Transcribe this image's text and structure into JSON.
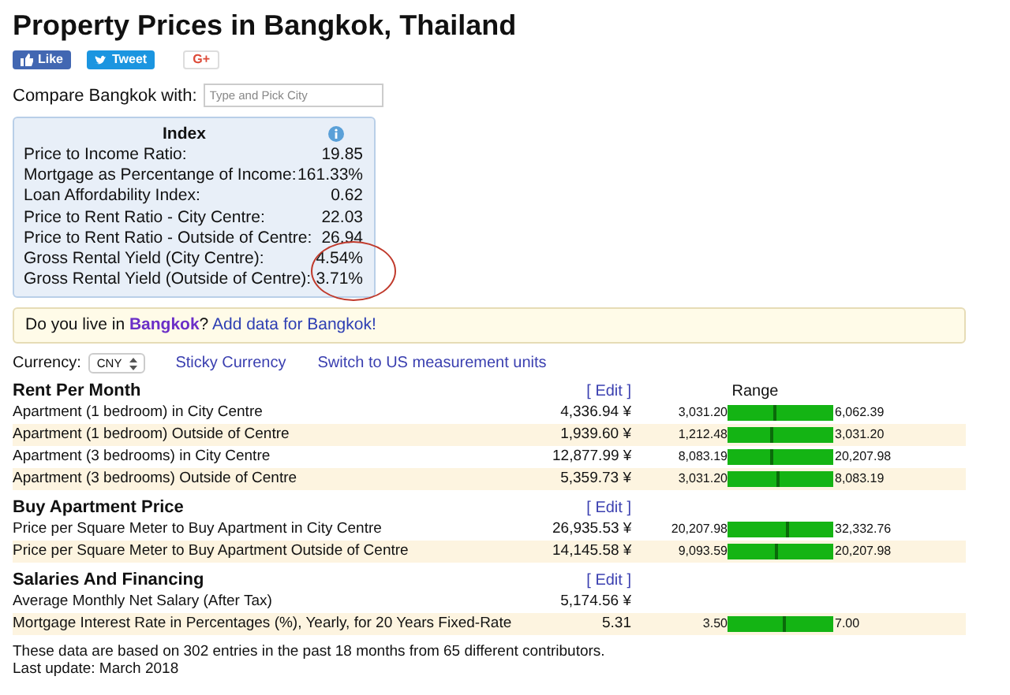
{
  "title": "Property Prices in Bangkok, Thailand",
  "social": [
    {
      "kind": "like",
      "label": "Like"
    },
    {
      "kind": "tweet",
      "label": "Tweet"
    },
    {
      "kind": "gplus",
      "label": "G+"
    }
  ],
  "compare": {
    "label": "Compare Bangkok with:",
    "placeholder": "Type and Pick City"
  },
  "index": {
    "title": "Index",
    "rows": [
      {
        "label": "Price to Income Ratio:",
        "value": "19.85",
        "circled": false
      },
      {
        "label": "Mortgage as Percentange of Income:",
        "value": "161.33%",
        "circled": false
      },
      {
        "label": "Loan Affordability Index:",
        "value": "0.62",
        "circled": false
      },
      {
        "label": "Price to Rent Ratio - City Centre:",
        "value": "22.03",
        "circled": false
      },
      {
        "label": "Price to Rent Ratio - Outside of Centre:",
        "value": "26.94",
        "circled": false
      },
      {
        "label": "Gross Rental Yield (City Centre):",
        "value": "4.54%",
        "circled": true
      },
      {
        "label": "Gross Rental Yield (Outside of Centre):",
        "value": "3.71%",
        "circled": true
      }
    ]
  },
  "notice": {
    "before": "Do you live in ",
    "city_link": "Bangkok",
    "between": "?",
    "add_link": "Add data for Bangkok!"
  },
  "currency": {
    "label": "Currency:",
    "value": "CNY",
    "links": [
      "Sticky Currency",
      "Switch to US measurement units"
    ]
  },
  "sections": [
    {
      "title": "Rent Per Month",
      "edit": "[ Edit ]",
      "range_heading": "Range",
      "rows": [
        {
          "label": "Apartment (1 bedroom) in City Centre",
          "value": "4,336.94 ¥",
          "low": "3,031.20",
          "high": "6,062.39",
          "level": 0.43
        },
        {
          "label": "Apartment (1 bedroom) Outside of Centre",
          "value": "1,939.60 ¥",
          "low": "1,212.48",
          "high": "3,031.20",
          "level": 0.4
        },
        {
          "label": "Apartment (3 bedrooms) in City Centre",
          "value": "12,877.99 ¥",
          "low": "8,083.19",
          "high": "20,207.98",
          "level": 0.4
        },
        {
          "label": "Apartment (3 bedrooms) Outside of Centre",
          "value": "5,359.73 ¥",
          "low": "3,031.20",
          "high": "8,083.19",
          "level": 0.46
        }
      ]
    },
    {
      "title": "Buy Apartment Price",
      "edit": "[ Edit ]",
      "rows": [
        {
          "label": "Price per Square Meter to Buy Apartment in City Centre",
          "value": "26,935.53 ¥",
          "low": "20,207.98",
          "high": "32,332.76",
          "level": 0.55
        },
        {
          "label": "Price per Square Meter to Buy Apartment Outside of Centre",
          "value": "14,145.58 ¥",
          "low": "9,093.59",
          "high": "20,207.98",
          "level": 0.45
        }
      ]
    },
    {
      "title": "Salaries And Financing",
      "edit": "[ Edit ]",
      "rows": [
        {
          "label": "Average Monthly Net Salary (After Tax)",
          "value": "5,174.56 ¥"
        },
        {
          "label": "Mortgage Interest Rate in Percentages (%), Yearly, for 20 Years Fixed-Rate",
          "value": "5.31",
          "low": "3.50",
          "high": "7.00",
          "level": 0.52
        }
      ]
    }
  ],
  "footer": [
    "These data are based on 302 entries in the past 18 months from 65 different contributors.",
    "Last update: March 2018"
  ]
}
